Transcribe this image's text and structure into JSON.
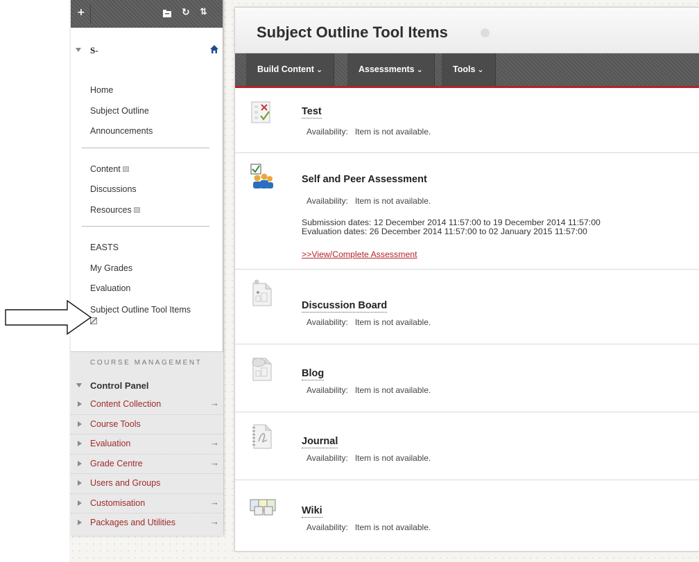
{
  "sidebar": {
    "toolbar": {
      "add": "+",
      "refresh": "↻",
      "sort": "⇅"
    },
    "course_name": "S-",
    "groups": [
      {
        "items": [
          {
            "label": "Home"
          },
          {
            "label": "Subject Outline"
          },
          {
            "label": "Announcements"
          }
        ]
      },
      {
        "items": [
          {
            "label": "Content"
          },
          {
            "label": "Discussions"
          },
          {
            "label": "Resources"
          }
        ]
      },
      {
        "items": [
          {
            "label": "EASTS"
          },
          {
            "label": "My Grades"
          },
          {
            "label": "Evaluation"
          },
          {
            "label": "Subject Outline Tool Items"
          }
        ]
      }
    ],
    "course_management": {
      "title": "Course Management",
      "control_panel": "Control Panel",
      "items": [
        {
          "label": "Content Collection",
          "arrow": "→"
        },
        {
          "label": "Course Tools",
          "arrow": ""
        },
        {
          "label": "Evaluation",
          "arrow": "→"
        },
        {
          "label": "Grade Centre",
          "arrow": "→"
        },
        {
          "label": "Users and Groups",
          "arrow": ""
        },
        {
          "label": "Customisation",
          "arrow": "→"
        },
        {
          "label": "Packages and Utilities",
          "arrow": "→"
        }
      ]
    }
  },
  "page": {
    "title": "Subject Outline Tool Items",
    "actions": [
      {
        "label": "Build Content",
        "chev": "⌄"
      },
      {
        "label": "Assessments",
        "chev": "⌄"
      },
      {
        "label": "Tools",
        "chev": "⌄"
      }
    ],
    "items": [
      {
        "title": "Test",
        "avail_key": "Availability:",
        "avail_val": "Item is not available."
      },
      {
        "title": "Self and Peer Assessment",
        "avail_key": "Availability:",
        "avail_val": "Item is not available.",
        "submission": "Submission dates: 12 December 2014 11:57:00 to 19 December 2014 11:57:00",
        "evaluation": "Evaluation dates: 26 December 2014 11:57:00 to 02 January 2015 11:57:00",
        "link": ">>View/Complete Assessment"
      },
      {
        "title": "Discussion Board",
        "avail_key": "Availability:",
        "avail_val": "Item is not available."
      },
      {
        "title": "Blog",
        "avail_key": "Availability:",
        "avail_val": "Item is not available."
      },
      {
        "title": "Journal",
        "avail_key": "Availability:",
        "avail_val": "Item is not available."
      },
      {
        "title": "Wiki",
        "avail_key": "Availability:",
        "avail_val": "Item is not available."
      }
    ]
  }
}
